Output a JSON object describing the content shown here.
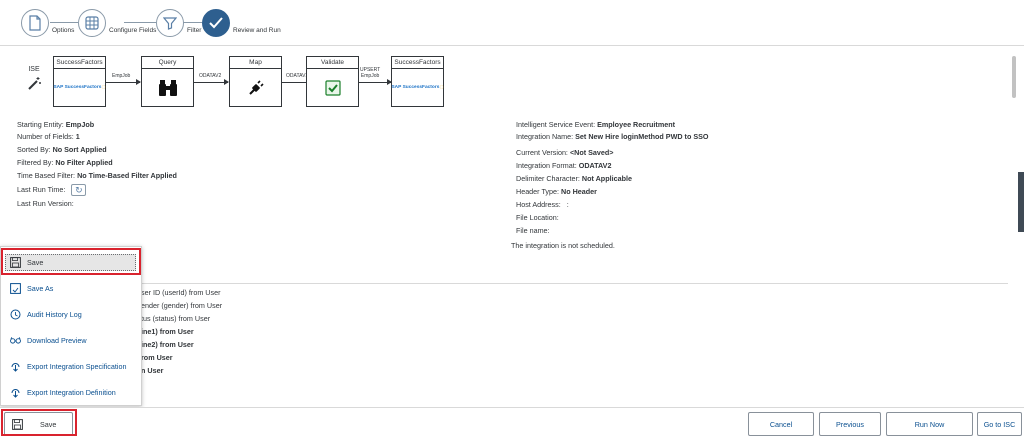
{
  "wizard": {
    "steps": [
      {
        "label": "Options"
      },
      {
        "label": "Configure Fields"
      },
      {
        "label": "Filter"
      },
      {
        "label": "Review and Run"
      }
    ]
  },
  "flow": {
    "start_label": "ISE",
    "boxes": [
      {
        "title": "SuccessFactors",
        "content": "SAP SuccessFactors"
      },
      {
        "title": "Query"
      },
      {
        "title": "Map"
      },
      {
        "title": "Validate"
      },
      {
        "title": "SuccessFactors",
        "content": "SAP SuccessFactors"
      }
    ],
    "arrows": [
      {
        "label": "EmpJob"
      },
      {
        "label": "ODATAV2"
      },
      {
        "label": "ODATAV2"
      },
      {
        "label": "UPSERT\nEmpJob"
      }
    ]
  },
  "info_left": [
    {
      "label": "Starting Entity:",
      "value": "EmpJob"
    },
    {
      "label": "Number of Fields:",
      "value": "1"
    },
    {
      "label": "Sorted By:",
      "value": "No Sort Applied"
    },
    {
      "label": "Filtered By:",
      "value": "No Filter Applied"
    },
    {
      "label": "Time Based Filter:",
      "value": "No Time-Based Filter Applied"
    },
    {
      "label": "Last Run Time:",
      "value": ""
    },
    {
      "label": "Last Run Version:",
      "value": ""
    }
  ],
  "info_right": [
    {
      "label": "Intelligent Service Event:",
      "value": "Employee Recruitment"
    },
    {
      "label": "Integration Name:",
      "value": "Set New Hire loginMethod PWD to SSO"
    },
    {
      "label": "Current Version:",
      "value": "<Not Saved>"
    },
    {
      "label": "Integration Format:",
      "value": "ODATAV2"
    },
    {
      "label": "Delimiter Character:",
      "value": "Not Applicable"
    },
    {
      "label": "Header Type:",
      "value": "No Header"
    },
    {
      "label": "Host Address:",
      "value": ":"
    },
    {
      "label": "File Location:",
      "value": ""
    },
    {
      "label": "File name:",
      "value": ""
    }
  ],
  "schedule_note": "The integration is not scheduled.",
  "field_rows": [
    {
      "text": "ser ID (userId) from User",
      "bold": false
    },
    {
      "text": "ender (gender) from User",
      "bold": false
    },
    {
      "text": "tus (status) from User",
      "bold": false
    },
    {
      "text": "ine1) from User",
      "bold": true
    },
    {
      "text": "ine2) from User",
      "bold": true
    },
    {
      "text": "rom User",
      "bold": true
    },
    {
      "text": "n User",
      "bold": true
    }
  ],
  "menu": {
    "items": [
      {
        "label": "Save",
        "icon": "save-icon"
      },
      {
        "label": "Save As",
        "icon": "save-as-icon"
      },
      {
        "label": "Audit History Log",
        "icon": "history-icon"
      },
      {
        "label": "Download Preview",
        "icon": "glasses-icon"
      },
      {
        "label": "Export Integration Specification",
        "icon": "download-icon"
      },
      {
        "label": "Export Integration Definition",
        "icon": "download-icon"
      }
    ]
  },
  "footer": {
    "save_label": "Save",
    "cancel_label": "Cancel",
    "previous_label": "Previous",
    "run_now_label": "Run Now",
    "go_to_isc_label": "Go to ISC"
  },
  "colors": {
    "accent": "#2e5f8f",
    "link": "#0a4f8f",
    "highlight": "#d9232e"
  }
}
